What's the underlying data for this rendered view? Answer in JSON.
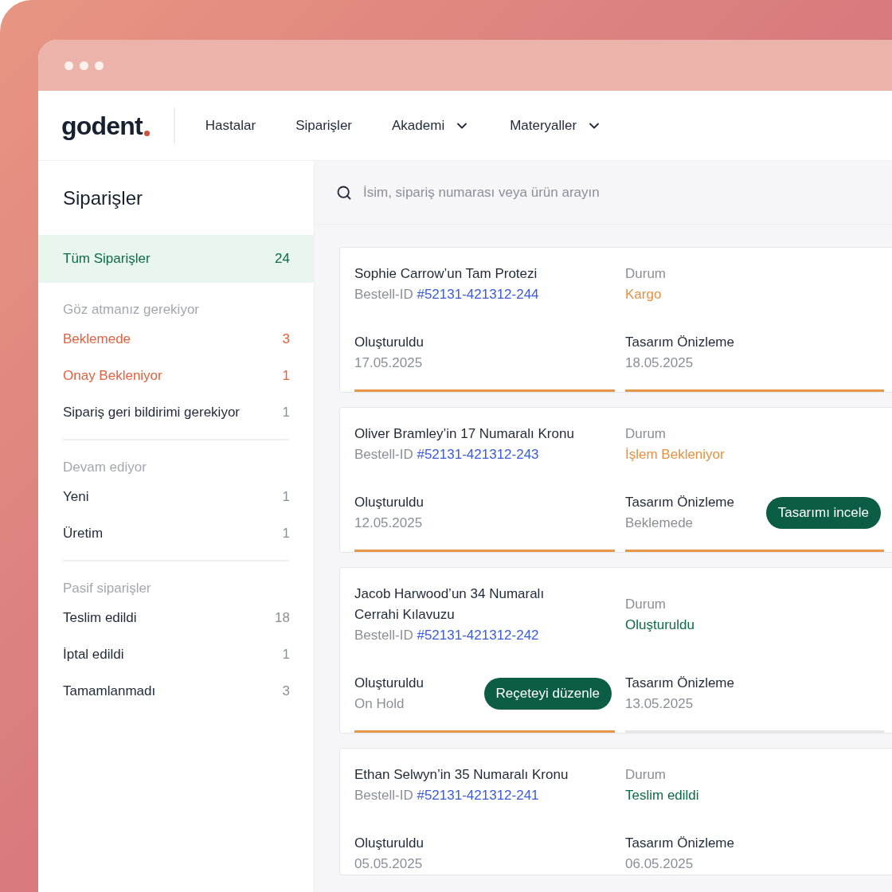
{
  "logo": {
    "text": "godent"
  },
  "nav": [
    {
      "label": "Hastalar",
      "dropdown": false
    },
    {
      "label": "Siparişler",
      "dropdown": false
    },
    {
      "label": "Akademi",
      "dropdown": true
    },
    {
      "label": "Materyaller",
      "dropdown": true
    }
  ],
  "sidebar": {
    "title": "Siparişler",
    "groups": [
      {
        "items": [
          {
            "label": "Tüm Siparişler",
            "count": "24",
            "selected": true,
            "alert": false
          }
        ]
      },
      {
        "heading": "Göz atmanız gerekiyor",
        "items": [
          {
            "label": "Beklemede",
            "count": "3",
            "selected": false,
            "alert": true
          },
          {
            "label": "Onay Bekleniyor",
            "count": "1",
            "selected": false,
            "alert": true
          },
          {
            "label": "Sipariş geri bildirimi gerekiyor",
            "count": "1",
            "selected": false,
            "alert": false
          }
        ]
      },
      {
        "heading": "Devam ediyor",
        "items": [
          {
            "label": "Yeni",
            "count": "1",
            "selected": false,
            "alert": false
          },
          {
            "label": "Üretim",
            "count": "1",
            "selected": false,
            "alert": false
          }
        ]
      },
      {
        "heading": "Pasif siparişler",
        "items": [
          {
            "label": "Teslim edildi",
            "count": "18",
            "selected": false,
            "alert": false
          },
          {
            "label": "İptal edildi",
            "count": "1",
            "selected": false,
            "alert": false
          },
          {
            "label": "Tamamlanmadı",
            "count": "3",
            "selected": false,
            "alert": false
          }
        ]
      }
    ]
  },
  "search": {
    "placeholder": "İsim, sipariş numarası veya ürün arayın"
  },
  "orders": [
    {
      "title": "Sophie Carrow’un Tam Protezi",
      "id_label": "Bestell-ID",
      "id": "#52131-421312-244",
      "status_label": "Durum",
      "status": {
        "text": "Kargo",
        "color": "#e8903f"
      },
      "fields": [
        {
          "label": "Oluşturuldu",
          "value": "17.05.2025",
          "done": true
        },
        {
          "label": "Tasarım Önizleme",
          "value": "18.05.2025",
          "done": true
        }
      ]
    },
    {
      "title": "Oliver Bramley’in 17 Numaralı Kronu",
      "id_label": "Bestell-ID",
      "id": "#52131-421312-243",
      "status_label": "Durum",
      "status": {
        "text": "İşlem Bekleniyor",
        "color": "#e8903f"
      },
      "fields": [
        {
          "label": "Oluşturuldu",
          "value": "12.05.2025",
          "done": true
        },
        {
          "label": "Tasarım Önizleme",
          "value": "Beklemede",
          "done": true,
          "button": "Tasarımı incele"
        }
      ]
    },
    {
      "title": "Jacob Harwood’un 34 Numaralı Cerrahi Kılavuzu",
      "id_label": "Bestell-ID",
      "id": "#52131-421312-242",
      "status_label": "Durum",
      "status": {
        "text": "Oluşturuldu",
        "color": "#0d6b47"
      },
      "fields": [
        {
          "label": "Oluşturuldu",
          "value": "On Hold",
          "done": true,
          "button": "Reçeteyi düzenle"
        },
        {
          "label": "Tasarım Önizleme",
          "value": "13.05.2025",
          "done": false
        }
      ]
    },
    {
      "title": "Ethan Selwyn’in 35 Numaralı Kronu",
      "id_label": "Bestell-ID",
      "id": "#52131-421312-241",
      "status_label": "Durum",
      "status": {
        "text": "Teslim edildi",
        "color": "#0d6b47"
      },
      "fields": [
        {
          "label": "Oluşturuldu",
          "value": "05.05.2025"
        },
        {
          "label": "Tasarım Önizleme",
          "value": "06.05.2025"
        }
      ]
    }
  ]
}
